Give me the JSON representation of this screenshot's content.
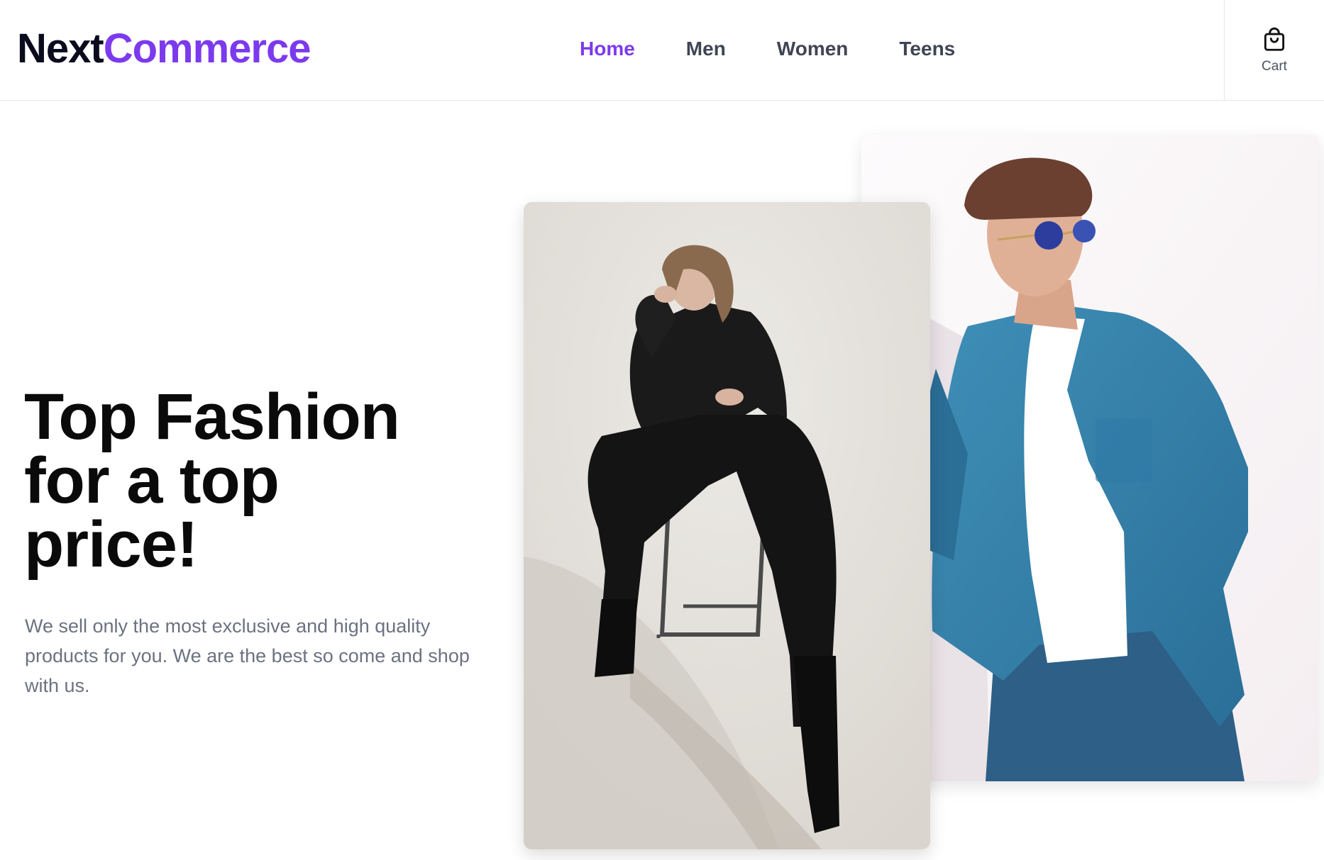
{
  "brand": {
    "part1": "Next",
    "part2": "Commerce"
  },
  "nav": {
    "items": [
      {
        "label": "Home",
        "active": true
      },
      {
        "label": "Men",
        "active": false
      },
      {
        "label": "Women",
        "active": false
      },
      {
        "label": "Teens",
        "active": false
      }
    ]
  },
  "cart": {
    "label": "Cart",
    "icon": "shopping-bag-icon"
  },
  "hero": {
    "headline_line1": "Top Fashion",
    "headline_line2": "for a top",
    "headline_line3": "price!",
    "description": "We sell only the most exclusive and high quality products for you. We are the best so come and shop with us."
  },
  "colors": {
    "accent": "#7c3aed",
    "brand_dark": "#0b0b1e",
    "nav_text": "#3f4553",
    "muted_text": "#6b7280",
    "border": "#e5e7eb"
  }
}
